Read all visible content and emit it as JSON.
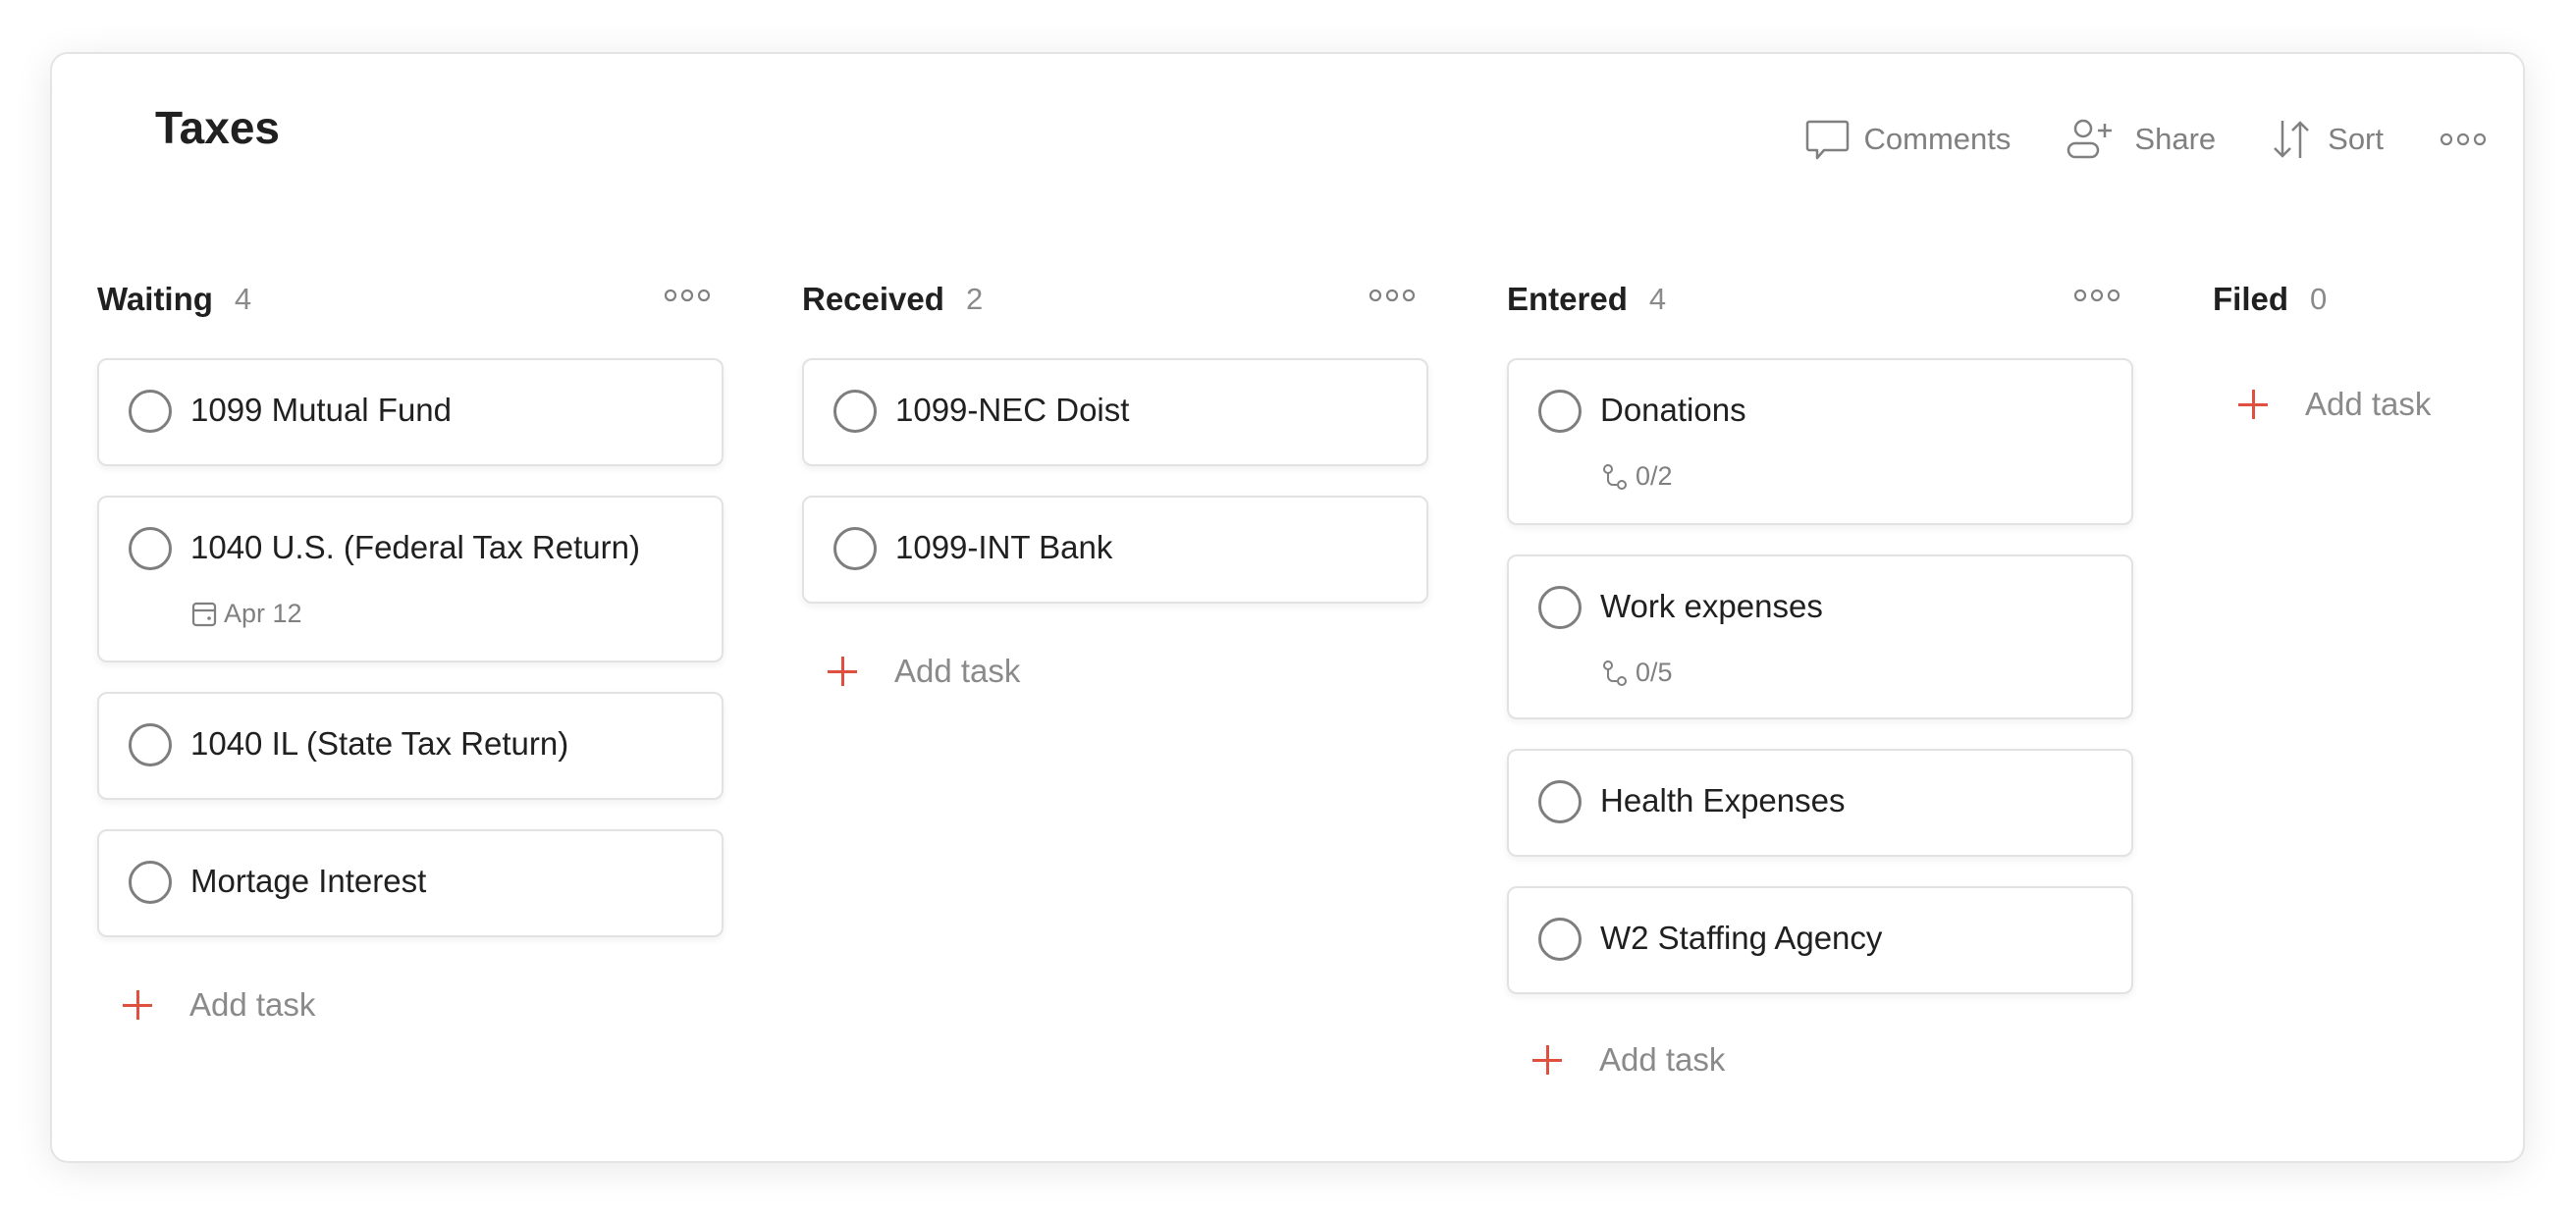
{
  "project": {
    "title": "Taxes"
  },
  "header_actions": {
    "comments": "Comments",
    "share": "Share",
    "sort": "Sort"
  },
  "accent_color": "#e0503f",
  "columns": [
    {
      "name": "Waiting",
      "count": "4",
      "tasks": [
        {
          "name": "1099 Mutual Fund"
        },
        {
          "name": "1040 U.S. (Federal Tax Return)",
          "due": "Apr 12"
        },
        {
          "name": "1040 IL (State Tax Return)"
        },
        {
          "name": "Mortage Interest"
        }
      ],
      "add_label": "Add task"
    },
    {
      "name": "Received",
      "count": "2",
      "tasks": [
        {
          "name": "1099-NEC Doist"
        },
        {
          "name": "1099-INT Bank"
        }
      ],
      "add_label": "Add task"
    },
    {
      "name": "Entered",
      "count": "4",
      "tasks": [
        {
          "name": "Donations",
          "subtasks": "0/2"
        },
        {
          "name": "Work expenses",
          "subtasks": "0/5"
        },
        {
          "name": "Health Expenses"
        },
        {
          "name": "W2 Staffing Agency"
        }
      ],
      "add_label": "Add task"
    },
    {
      "name": "Filed",
      "count": "0",
      "tasks": [],
      "add_label": "Add task"
    }
  ]
}
